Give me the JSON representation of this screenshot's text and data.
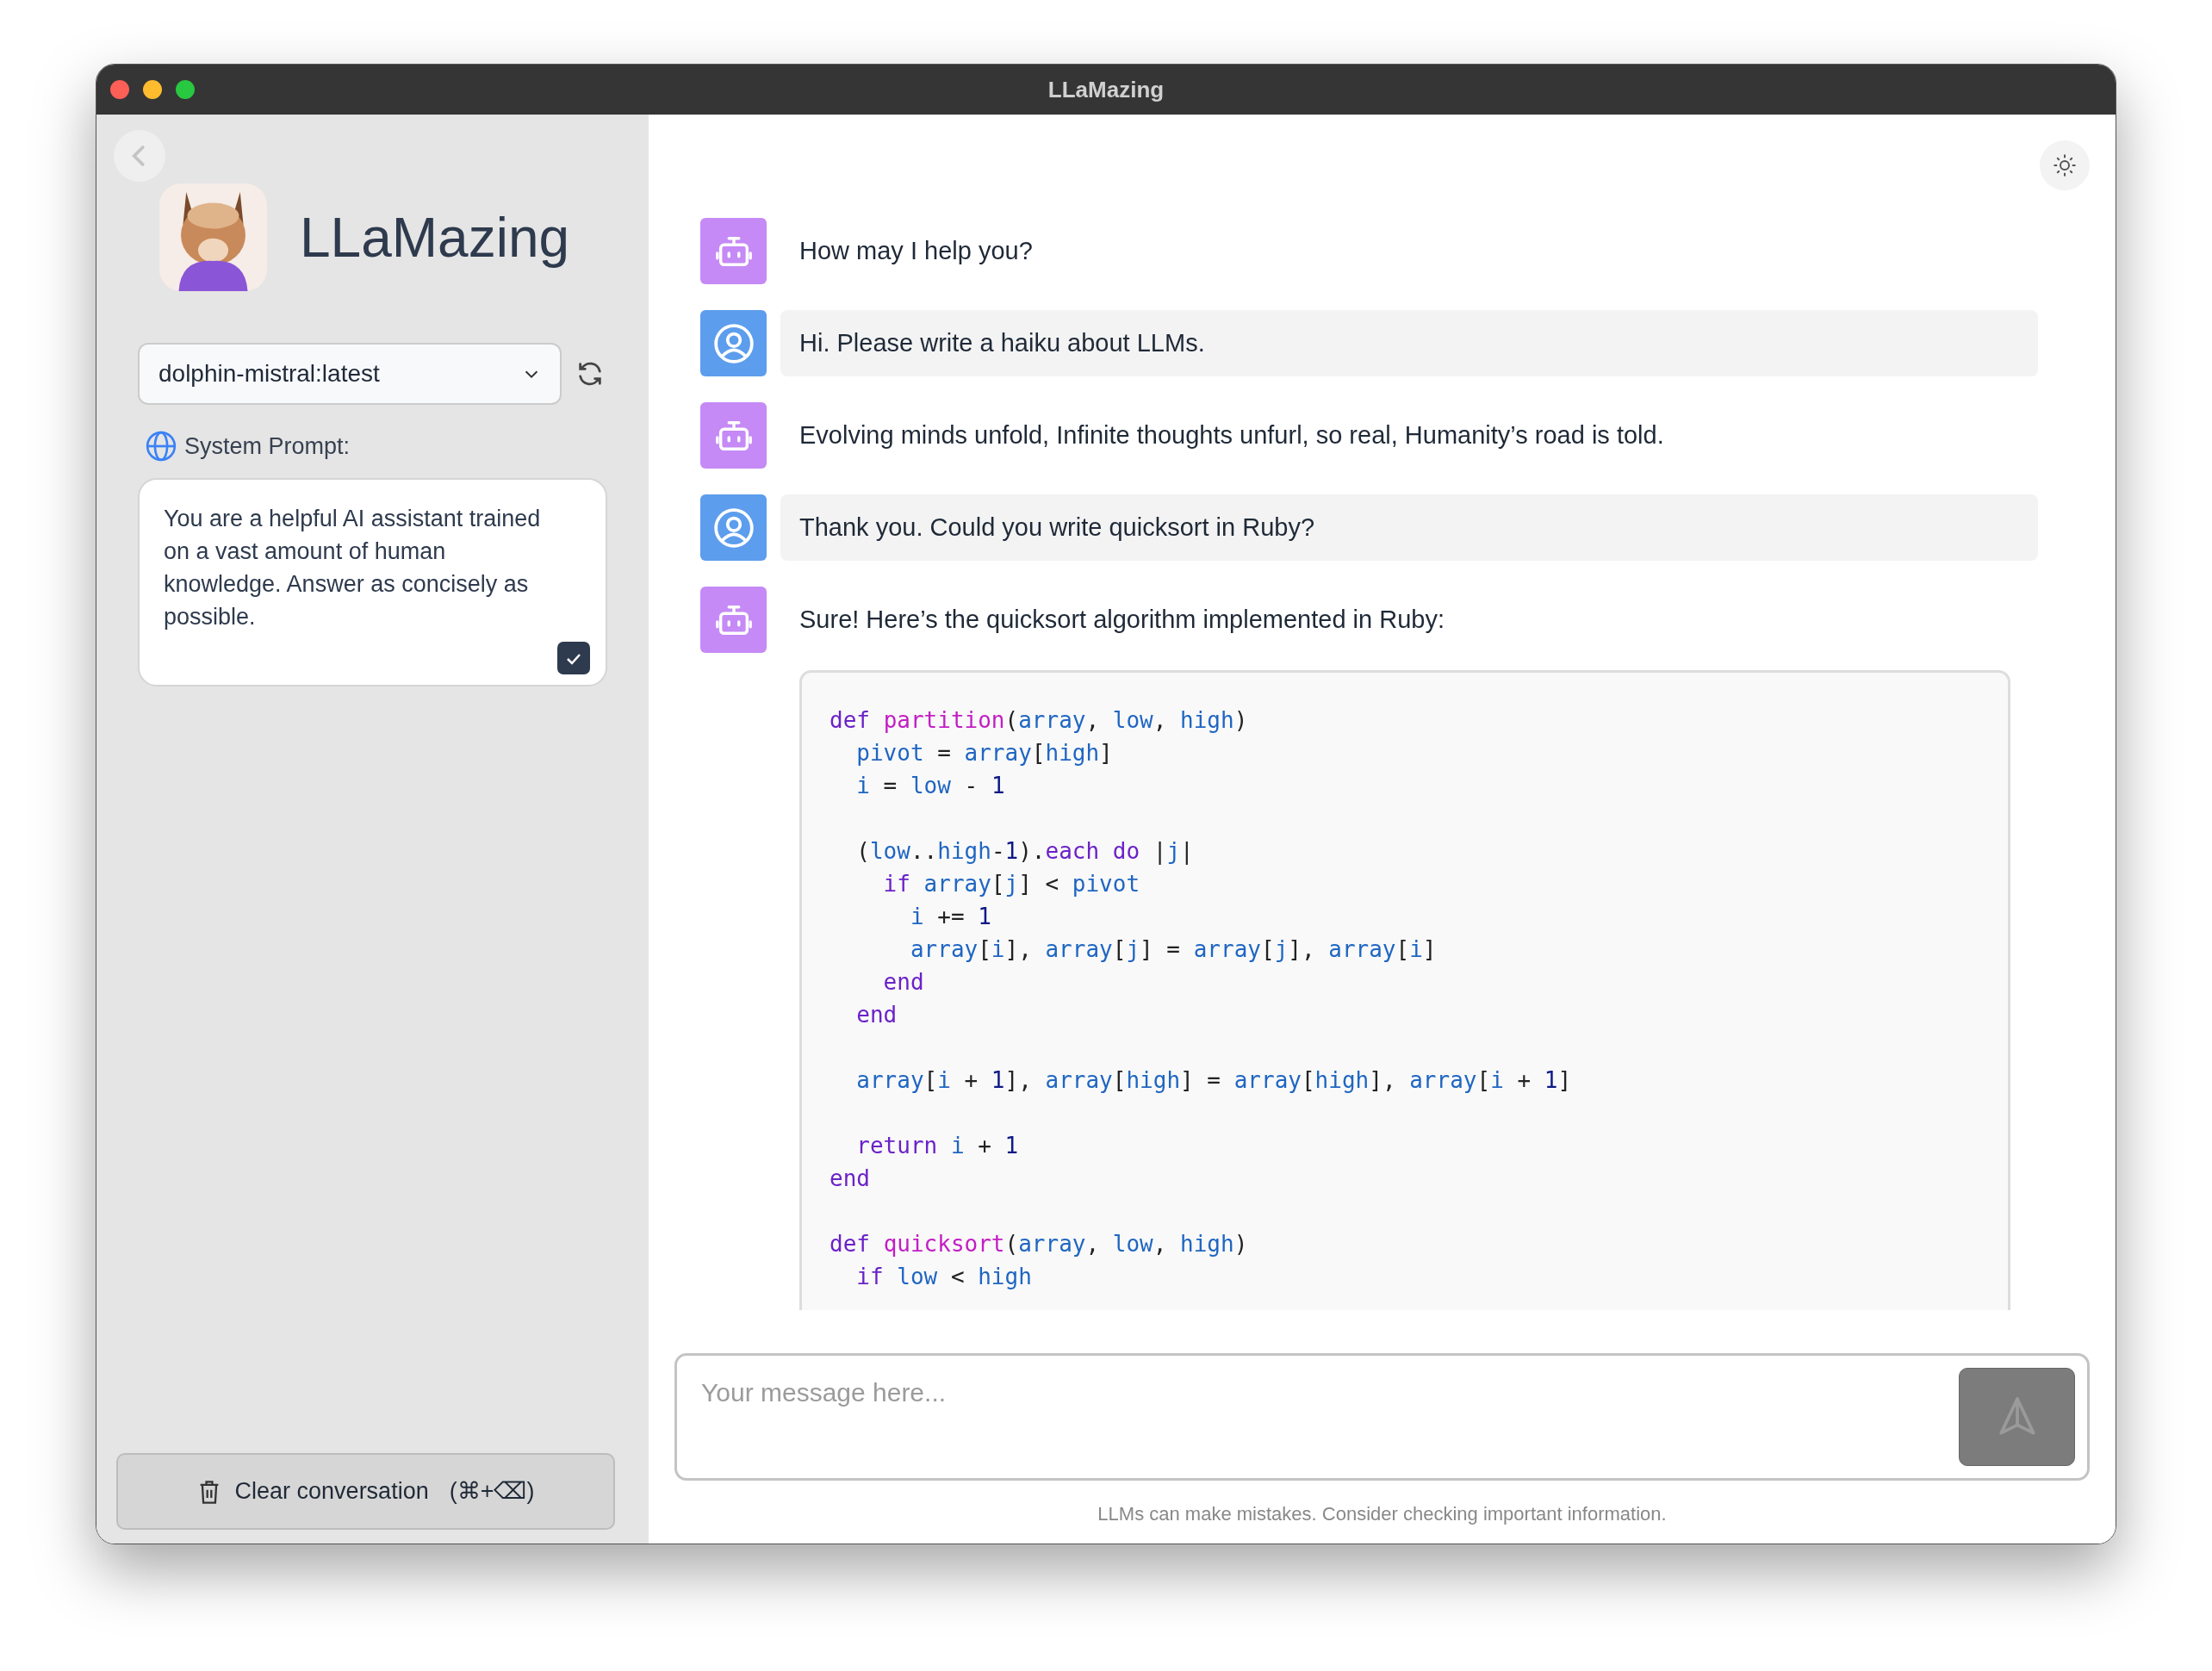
{
  "window": {
    "title": "LLaMazing"
  },
  "sidebar": {
    "app_name": "LLaMazing",
    "model_select": {
      "value": "dolphin-mistral:latest"
    },
    "system_prompt": {
      "label": "System Prompt:",
      "value": "You are a helpful AI assistant trained on a vast amount of human knowledge. Answer as concisely as possible."
    },
    "clear_button": {
      "label": "Clear conversation",
      "shortcut": "(⌘+⌫)"
    }
  },
  "messages": [
    {
      "kind": "bot",
      "text": "How may I help you?"
    },
    {
      "kind": "user",
      "text": "Hi. Please write a haiku about LLMs."
    },
    {
      "kind": "bot",
      "text": "Evolving minds unfold, Infinite thoughts unfurl, so real, Humanity’s road is told."
    },
    {
      "kind": "user",
      "text": "Thank you. Could you write quicksort in Ruby?"
    },
    {
      "kind": "bot",
      "text": "Sure! Here’s the quicksort algorithm implemented in Ruby:",
      "code": [
        {
          "gap_before": false,
          "tokens": [
            {
              "kind": "keyword",
              "text": "def "
            },
            {
              "kind": "function",
              "text": "partition"
            },
            {
              "kind": "plain",
              "text": "("
            },
            {
              "kind": "name",
              "text": "array"
            },
            {
              "kind": "plain",
              "text": ", "
            },
            {
              "kind": "name",
              "text": "low"
            },
            {
              "kind": "plain",
              "text": ", "
            },
            {
              "kind": "name",
              "text": "high"
            },
            {
              "kind": "plain",
              "text": ")"
            }
          ]
        },
        {
          "gap_before": false,
          "tokens": [
            {
              "kind": "name",
              "text": "  pivot"
            },
            {
              "kind": "plain",
              "text": " = "
            },
            {
              "kind": "name",
              "text": "array"
            },
            {
              "kind": "plain",
              "text": "["
            },
            {
              "kind": "name",
              "text": "high"
            },
            {
              "kind": "plain",
              "text": "]"
            }
          ]
        },
        {
          "gap_before": false,
          "tokens": [
            {
              "kind": "name",
              "text": "  i"
            },
            {
              "kind": "plain",
              "text": " = "
            },
            {
              "kind": "name",
              "text": "low"
            },
            {
              "kind": "plain",
              "text": " - "
            },
            {
              "kind": "number",
              "text": "1"
            }
          ]
        },
        {
          "gap_before": true,
          "tokens": [
            {
              "kind": "plain",
              "text": "  ("
            },
            {
              "kind": "name",
              "text": "low"
            },
            {
              "kind": "plain",
              "text": ".."
            },
            {
              "kind": "name",
              "text": "high"
            },
            {
              "kind": "plain",
              "text": "-"
            },
            {
              "kind": "number",
              "text": "1"
            },
            {
              "kind": "plain",
              "text": ")."
            },
            {
              "kind": "keyword",
              "text": "each do"
            },
            {
              "kind": "plain",
              "text": " |"
            },
            {
              "kind": "name",
              "text": "j"
            },
            {
              "kind": "plain",
              "text": "|"
            }
          ]
        },
        {
          "gap_before": false,
          "tokens": [
            {
              "kind": "keyword",
              "text": "    if "
            },
            {
              "kind": "name",
              "text": "array"
            },
            {
              "kind": "plain",
              "text": "["
            },
            {
              "kind": "name",
              "text": "j"
            },
            {
              "kind": "plain",
              "text": "] < "
            },
            {
              "kind": "name",
              "text": "pivot"
            }
          ]
        },
        {
          "gap_before": false,
          "tokens": [
            {
              "kind": "name",
              "text": "      i"
            },
            {
              "kind": "plain",
              "text": " += "
            },
            {
              "kind": "number",
              "text": "1"
            }
          ]
        },
        {
          "gap_before": false,
          "tokens": [
            {
              "kind": "name",
              "text": "      array"
            },
            {
              "kind": "plain",
              "text": "["
            },
            {
              "kind": "name",
              "text": "i"
            },
            {
              "kind": "plain",
              "text": "], "
            },
            {
              "kind": "name",
              "text": "array"
            },
            {
              "kind": "plain",
              "text": "["
            },
            {
              "kind": "name",
              "text": "j"
            },
            {
              "kind": "plain",
              "text": "] = "
            },
            {
              "kind": "name",
              "text": "array"
            },
            {
              "kind": "plain",
              "text": "["
            },
            {
              "kind": "name",
              "text": "j"
            },
            {
              "kind": "plain",
              "text": "], "
            },
            {
              "kind": "name",
              "text": "array"
            },
            {
              "kind": "plain",
              "text": "["
            },
            {
              "kind": "name",
              "text": "i"
            },
            {
              "kind": "plain",
              "text": "]"
            }
          ]
        },
        {
          "gap_before": false,
          "tokens": [
            {
              "kind": "keyword",
              "text": "    end"
            }
          ]
        },
        {
          "gap_before": false,
          "tokens": [
            {
              "kind": "keyword",
              "text": "  end"
            }
          ]
        },
        {
          "gap_before": true,
          "tokens": [
            {
              "kind": "name",
              "text": "  array"
            },
            {
              "kind": "plain",
              "text": "["
            },
            {
              "kind": "name",
              "text": "i"
            },
            {
              "kind": "plain",
              "text": " + "
            },
            {
              "kind": "number",
              "text": "1"
            },
            {
              "kind": "plain",
              "text": "], "
            },
            {
              "kind": "name",
              "text": "array"
            },
            {
              "kind": "plain",
              "text": "["
            },
            {
              "kind": "name",
              "text": "high"
            },
            {
              "kind": "plain",
              "text": "] = "
            },
            {
              "kind": "name",
              "text": "array"
            },
            {
              "kind": "plain",
              "text": "["
            },
            {
              "kind": "name",
              "text": "high"
            },
            {
              "kind": "plain",
              "text": "], "
            },
            {
              "kind": "name",
              "text": "array"
            },
            {
              "kind": "plain",
              "text": "["
            },
            {
              "kind": "name",
              "text": "i"
            },
            {
              "kind": "plain",
              "text": " + "
            },
            {
              "kind": "number",
              "text": "1"
            },
            {
              "kind": "plain",
              "text": "]"
            }
          ]
        },
        {
          "gap_before": true,
          "tokens": [
            {
              "kind": "keyword",
              "text": "  return "
            },
            {
              "kind": "name",
              "text": "i"
            },
            {
              "kind": "plain",
              "text": " + "
            },
            {
              "kind": "number",
              "text": "1"
            }
          ]
        },
        {
          "gap_before": false,
          "tokens": [
            {
              "kind": "keyword",
              "text": "end"
            }
          ]
        },
        {
          "gap_before": true,
          "tokens": [
            {
              "kind": "keyword",
              "text": "def "
            },
            {
              "kind": "function",
              "text": "quicksort"
            },
            {
              "kind": "plain",
              "text": "("
            },
            {
              "kind": "name",
              "text": "array"
            },
            {
              "kind": "plain",
              "text": ", "
            },
            {
              "kind": "name",
              "text": "low"
            },
            {
              "kind": "plain",
              "text": ", "
            },
            {
              "kind": "name",
              "text": "high"
            },
            {
              "kind": "plain",
              "text": ")"
            }
          ]
        },
        {
          "gap_before": false,
          "tokens": [
            {
              "kind": "keyword",
              "text": "  if "
            },
            {
              "kind": "name",
              "text": "low"
            },
            {
              "kind": "plain",
              "text": " < "
            },
            {
              "kind": "name",
              "text": "high"
            }
          ]
        }
      ]
    }
  ],
  "composer": {
    "placeholder": "Your message here..."
  },
  "footer": "LLMs can make mistakes. Consider checking important information."
}
